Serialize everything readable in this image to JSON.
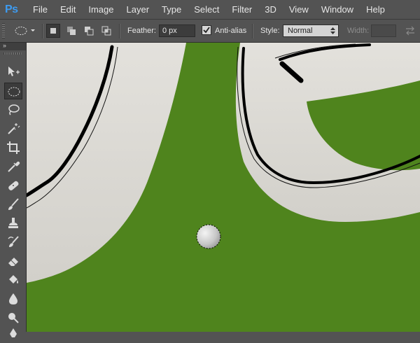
{
  "app": {
    "logo_text": "Ps"
  },
  "menu": [
    "File",
    "Edit",
    "Image",
    "Layer",
    "Type",
    "Select",
    "Filter",
    "3D",
    "View",
    "Window",
    "Help"
  ],
  "options": {
    "feather_label": "Feather:",
    "feather_value": "0 px",
    "antialias_label": "Anti-alias",
    "antialias_checked": true,
    "style_label": "Style:",
    "style_value": "Normal",
    "width_label": "Width:"
  },
  "toolbar": {
    "collapse_glyph": "››",
    "active_tool": "elliptical-marquee",
    "tools": [
      "move",
      "elliptical-marquee",
      "lasso",
      "magic-wand",
      "crop",
      "eyedropper",
      "spot-healing-brush",
      "brush",
      "clone-stamp",
      "history-brush",
      "eraser",
      "paint-bucket",
      "blur",
      "dodge",
      "pen"
    ]
  },
  "canvas": {
    "colors": {
      "background": "#4f841d",
      "shape_fill": "#dedcd6",
      "outline": "#000000"
    }
  }
}
